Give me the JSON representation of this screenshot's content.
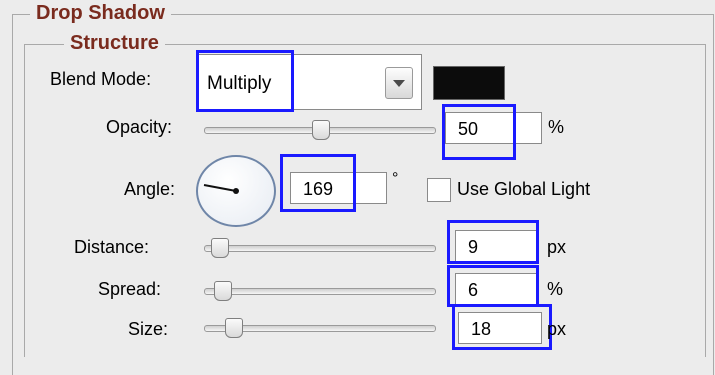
{
  "drop_shadow_title": "Drop Shadow",
  "structure_title": "Structure",
  "blend_mode": {
    "label": "Blend Mode:",
    "value": "Multiply",
    "color": "#0c0c0c"
  },
  "opacity": {
    "label": "Opacity:",
    "value": "50",
    "unit": "%",
    "slider_fraction": 0.5
  },
  "angle": {
    "label": "Angle:",
    "value": "169",
    "unit": "°",
    "use_global_light_label": "Use Global Light",
    "use_global_light_checked": false
  },
  "distance": {
    "label": "Distance:",
    "value": "9",
    "unit": "px",
    "slider_fraction": 0.03
  },
  "spread": {
    "label": "Spread:",
    "value": "6",
    "unit": "%",
    "slider_fraction": 0.06
  },
  "size": {
    "label": "Size:",
    "value": "18",
    "unit": "px",
    "slider_fraction": 0.07
  },
  "highlight_color": "#1a1aff"
}
